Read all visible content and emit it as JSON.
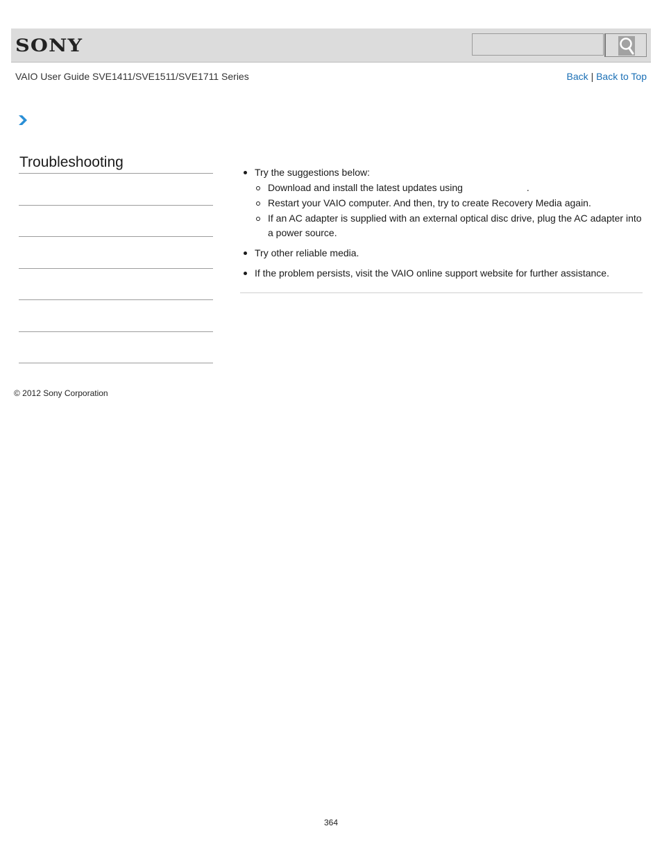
{
  "header": {
    "brand": "SONY",
    "search": {
      "placeholder": "",
      "value": ""
    },
    "search_icon": "magnifier-icon"
  },
  "nav": {
    "guide_title": "VAIO User Guide SVE1411/SVE1511/SVE1711 Series",
    "back_label": "Back",
    "separator": "|",
    "back_to_top_label": "Back to Top",
    "link_color": "#1a6fb5"
  },
  "breadcrumb": {
    "icon": "chevron-right-icon",
    "accent": "#2a8fd6"
  },
  "sidebar": {
    "title": "Troubleshooting",
    "items": [
      "",
      "",
      "",
      "",
      "",
      ""
    ]
  },
  "content": {
    "items": [
      {
        "text": "Try the suggestions below:",
        "subitems": [
          {
            "before": "Download and install the latest updates using",
            "link": "",
            "after": "."
          },
          {
            "text": "Restart your VAIO computer. And then, try to create Recovery Media again."
          },
          {
            "text": "If an AC adapter is supplied with an external optical disc drive, plug the AC adapter into a power source."
          }
        ]
      },
      {
        "text": "Try other reliable media."
      },
      {
        "text": "If the problem persists, visit the VAIO online support website for further assistance."
      }
    ]
  },
  "footer": {
    "copyright": "© 2012 Sony Corporation",
    "page_number": "364"
  }
}
